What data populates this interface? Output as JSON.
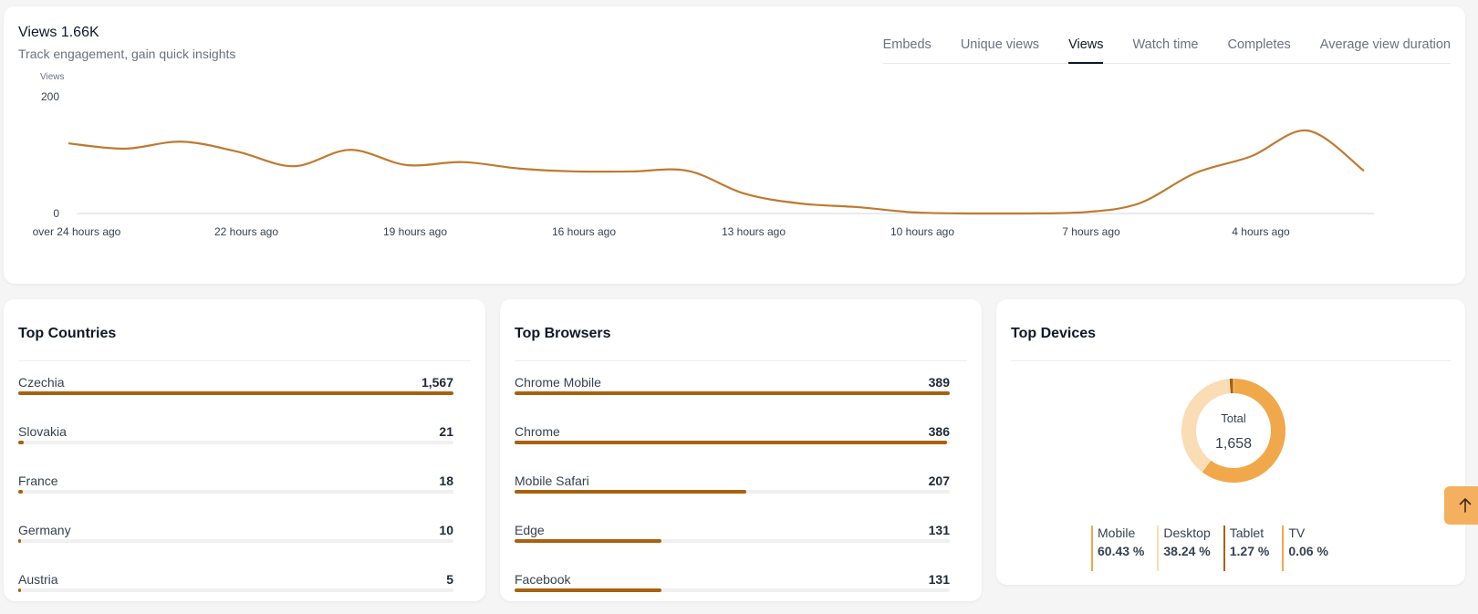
{
  "header": {
    "title": "Views 1.66K",
    "subtitle": "Track engagement, gain quick insights"
  },
  "tabs": [
    {
      "label": "Embeds",
      "active": false
    },
    {
      "label": "Unique views",
      "active": false
    },
    {
      "label": "Views",
      "active": true
    },
    {
      "label": "Watch time",
      "active": false
    },
    {
      "label": "Completes",
      "active": false
    },
    {
      "label": "Average view duration",
      "active": false
    }
  ],
  "chart_data": {
    "type": "line",
    "ylabel": "Views",
    "ylim": [
      0,
      200
    ],
    "yticks": [
      0,
      200
    ],
    "xtick_labels": [
      "over 24 hours ago",
      "22 hours ago",
      "19 hours ago",
      "16 hours ago",
      "13 hours ago",
      "10 hours ago",
      "7 hours ago",
      "4 hours ago"
    ],
    "series": [
      {
        "name": "Views",
        "color": "#bf7a30",
        "values": [
          120,
          111,
          123,
          106,
          81,
          109,
          83,
          88,
          77,
          72,
          72,
          73,
          34,
          17,
          11,
          2,
          0,
          0,
          2,
          17,
          69,
          98,
          142,
          73
        ]
      }
    ],
    "grid": false
  },
  "countries": {
    "title": "Top Countries",
    "items": [
      {
        "label": "Czechia",
        "value": "1,567",
        "fraction": 1.0
      },
      {
        "label": "Slovakia",
        "value": "21",
        "fraction": 0.013
      },
      {
        "label": "France",
        "value": "18",
        "fraction": 0.011
      },
      {
        "label": "Germany",
        "value": "10",
        "fraction": 0.006
      },
      {
        "label": "Austria",
        "value": "5",
        "fraction": 0.003
      }
    ]
  },
  "browsers": {
    "title": "Top Browsers",
    "items": [
      {
        "label": "Chrome Mobile",
        "value": "389",
        "fraction": 1.0
      },
      {
        "label": "Chrome",
        "value": "386",
        "fraction": 0.993
      },
      {
        "label": "Mobile Safari",
        "value": "207",
        "fraction": 0.532
      },
      {
        "label": "Edge",
        "value": "131",
        "fraction": 0.337
      },
      {
        "label": "Facebook",
        "value": "131",
        "fraction": 0.337
      }
    ]
  },
  "devices": {
    "title": "Top Devices",
    "total_label": "Total",
    "total_value": "1,658",
    "items": [
      {
        "label": "Mobile",
        "value": "60.43 %",
        "percent": 60.43,
        "color": "#f0a84a"
      },
      {
        "label": "Desktop",
        "value": "38.24 %",
        "percent": 38.24,
        "color": "#fadcb5"
      },
      {
        "label": "Tablet",
        "value": "1.27 %",
        "percent": 1.27,
        "color": "#a8610e"
      },
      {
        "label": "TV",
        "value": "0.06 %",
        "percent": 0.06,
        "color": "#f0a84a"
      }
    ]
  },
  "scroll_top": {
    "icon": "arrow-up-icon"
  }
}
